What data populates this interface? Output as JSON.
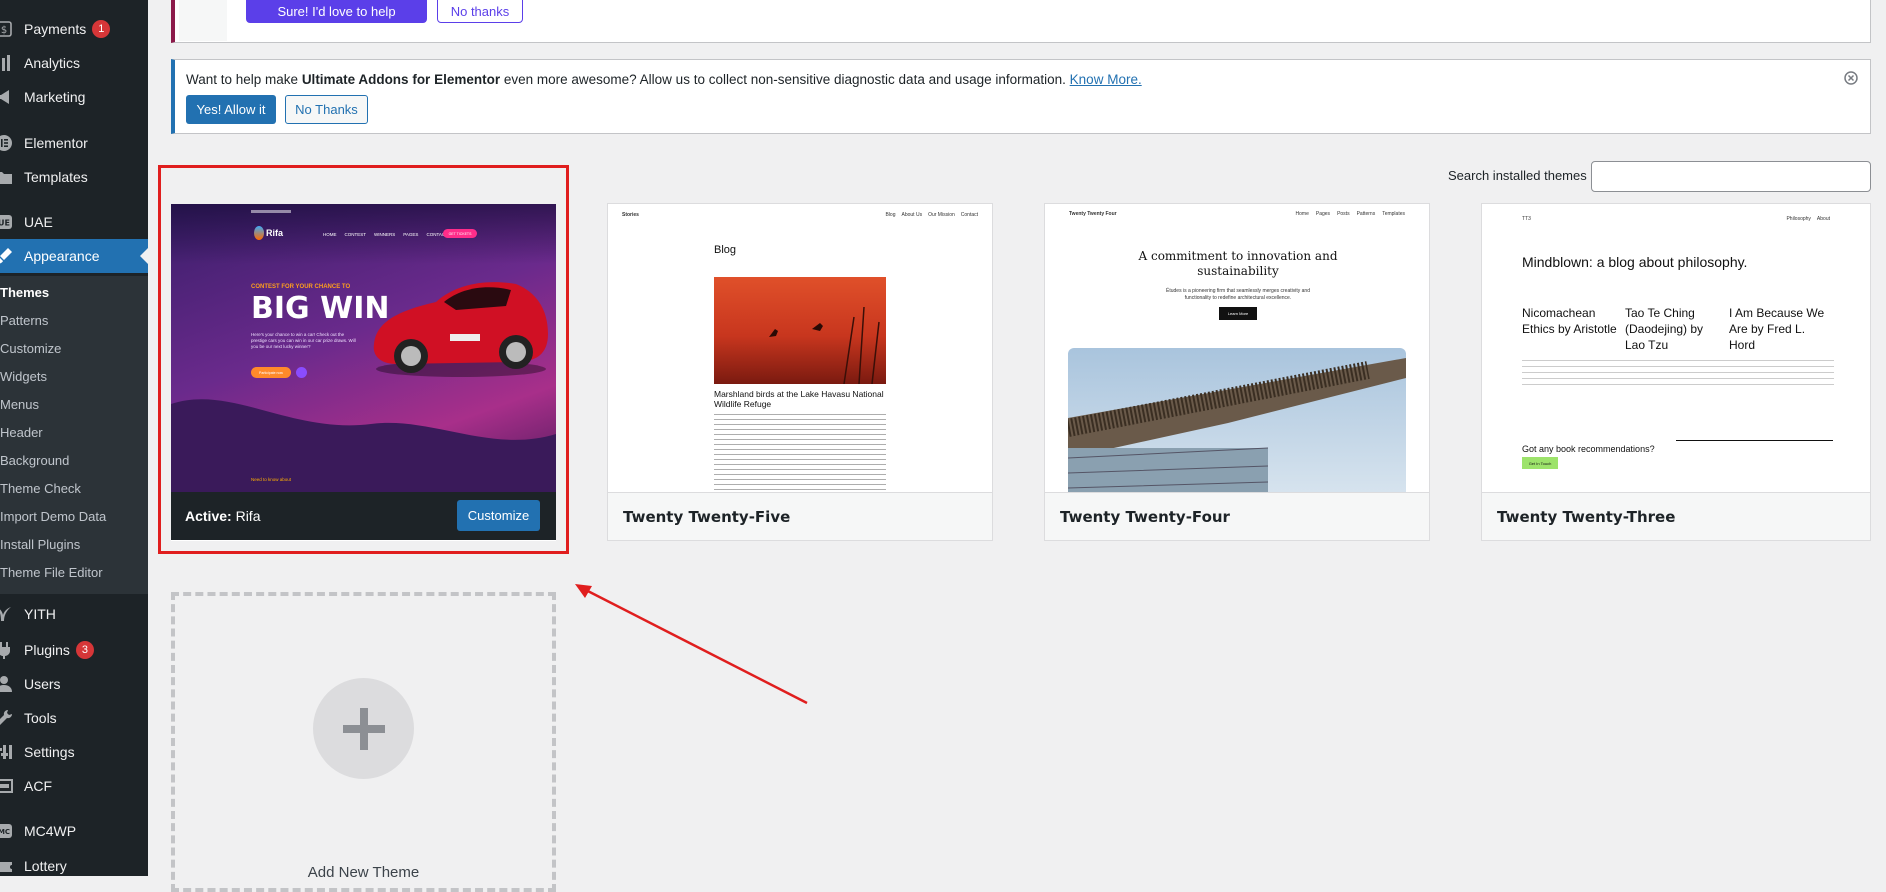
{
  "sidebar": {
    "items": [
      {
        "label": "Payments",
        "icon": "dollar-icon",
        "badge": "1"
      },
      {
        "label": "Analytics",
        "icon": "bar-chart-icon"
      },
      {
        "label": "Marketing",
        "icon": "megaphone-icon"
      },
      {
        "label": "Elementor",
        "icon": "elementor-icon"
      },
      {
        "label": "Templates",
        "icon": "folder-icon"
      },
      {
        "label": "UAE",
        "icon": "uae-icon"
      },
      {
        "label": "Appearance",
        "icon": "paintbrush-icon"
      },
      {
        "label": "YITH",
        "icon": "yith-icon"
      },
      {
        "label": "Plugins",
        "icon": "plug-icon",
        "badge": "3"
      },
      {
        "label": "Users",
        "icon": "users-icon"
      },
      {
        "label": "Tools",
        "icon": "wrench-icon"
      },
      {
        "label": "Settings",
        "icon": "settings-icon"
      },
      {
        "label": "ACF",
        "icon": "acf-icon"
      },
      {
        "label": "MC4WP",
        "icon": "mc4wp-icon"
      },
      {
        "label": "Lottery",
        "icon": "lottery-icon"
      }
    ],
    "submenu": [
      "Themes",
      "Patterns",
      "Customize",
      "Widgets",
      "Menus",
      "Header",
      "Background",
      "Theme Check",
      "Import Demo Data",
      "Install Plugins",
      "Theme File Editor"
    ]
  },
  "top_notice": {
    "yes": "Sure! I'd love to help",
    "no": "No thanks"
  },
  "uae_notice": {
    "text_before": "Want to help make ",
    "text_bold": "Ultimate Addons for Elementor",
    "text_after": " even more awesome? Allow us to collect non-sensitive diagnostic data and usage information. ",
    "link": "Know More.",
    "allow": "Yes! Allow it",
    "deny": "No Thanks"
  },
  "search": {
    "label": "Search installed themes",
    "value": ""
  },
  "themes": {
    "active": {
      "prefix": "Active:",
      "name": "Rifa",
      "customize": "Customize",
      "shot": {
        "nav": [
          "HOME",
          "CONTEST",
          "WINNERS",
          "PAGES",
          "CONTACT"
        ],
        "logo": "Rifa",
        "cta_top": "GET TICKETS",
        "kicker": "CONTEST FOR YOUR CHANCE TO",
        "headline": "BIG WIN",
        "body": "Here's your chance to win a car! Check out the prestige cars you can win in our car prize draws. Will you be our next lucky winner?",
        "btn": "Participate now",
        "footer": "Need to know about"
      }
    },
    "t25": {
      "name": "Twenty Twenty-Five",
      "site": "Stories",
      "nav": [
        "Blog",
        "About Us",
        "Our Mission",
        "Contact"
      ],
      "heading": "Blog",
      "caption": "Marshland birds at the Lake Havasu National Wildlife Refuge"
    },
    "t24": {
      "name": "Twenty Twenty-Four",
      "site": "Twenty Twenty Four",
      "nav": [
        "Home",
        "Pages",
        "Posts",
        "Patterns",
        "Templates"
      ],
      "heading": "A commitment to innovation and sustainability",
      "body": "Études is a pioneering firm that seamlessly merges creativity and functionality to redefine architectural excellence.",
      "btn": "Learn More"
    },
    "t23": {
      "name": "Twenty Twenty-Three",
      "site": "TT3",
      "nav": [
        "Philosophy",
        "About"
      ],
      "heading": "Mindblown: a blog about philosophy.",
      "posts": [
        "Nicomachean Ethics by Aristotle",
        "Tao Te Ching (Daodejing) by Lao Tzu",
        "I Am Because We Are by Fred L. Hord"
      ],
      "cta": "Got any book recommendations?",
      "btn": "Get In Touch"
    },
    "add_new": "Add New Theme"
  },
  "colors": {
    "accent": "#2271b1",
    "sidebar": "#1d2327",
    "highlight": "#e01e1e"
  }
}
